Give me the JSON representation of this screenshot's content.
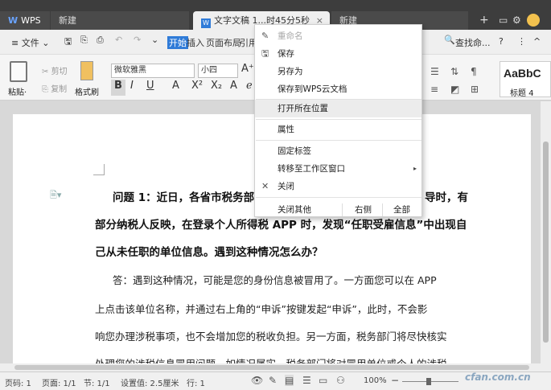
{
  "titlebar": {
    "tabs": [
      {
        "label": "WPS",
        "logo": "W"
      },
      {
        "label": "新建"
      },
      {
        "label": "文字文稿 1...时45分5秒"
      },
      {
        "label": "新建"
      }
    ],
    "add_label": "+",
    "close_label": "×"
  },
  "menu": {
    "file": "≡ 文件 ⌄",
    "start": "开始",
    "insert": "插入",
    "layout": "页面布局",
    "ref": "引用",
    "find": "查找命...",
    "help": "?",
    "more": "⋮",
    "collapse": "^"
  },
  "ribbon": {
    "paste": "粘贴·",
    "cut": "剪切",
    "copy": "复制",
    "format_painter": "格式刷",
    "font": "微软雅黑",
    "size": "小四",
    "style_preview": "AaBbC",
    "style_label": "标题 4"
  },
  "document": {
    "lines": [
      "问题 1：近日，各省市税务部",
      "部分纳税人反映，在登录个人所得税 APP 时，发现“任职受雇信息”中出现自",
      "己从未任职的单位信息。遇到这种情况怎么办？",
      "答：遇到这种情况，可能是您的身份信息被冒用了。一方面您可以在 APP",
      "上点击该单位名称，并通过右上角的“申诉”按键发起“申诉”，此时，不会影",
      "响您办理涉税事项，也不会增加您的税收负担。另一方面，税务部门将尽快核实",
      "处理您的涉税信息冒用问题，如情况属实，税务部门将对冒用单位或个人的涉税"
    ],
    "q_tail": "导时，有"
  },
  "context_menu": {
    "items": [
      {
        "label": "重命名",
        "icon": "pencil-icon",
        "disabled": true
      },
      {
        "label": "保存",
        "icon": "floppy-icon"
      },
      {
        "label": "另存为"
      },
      {
        "label": "保存到WPS云文档"
      },
      {
        "label": "打开所在位置"
      },
      {
        "label": "属性"
      },
      {
        "label": "固定标签"
      },
      {
        "label": "转移至工作区窗口"
      },
      {
        "label": "关闭",
        "icon": "close-icon"
      }
    ],
    "close_others": "关闭其他",
    "right_side": "右侧",
    "all": "全部"
  },
  "statusbar": {
    "page_count": "页码: 1",
    "pages": "页面: 1/1",
    "section": "节: 1/1",
    "setting": "设置值: 2.5厘米",
    "row": "行: 1",
    "zoom": "100%",
    "zoom_minus": "−",
    "zoom_plus": "+",
    "watermark": "cfan.com.cn"
  }
}
